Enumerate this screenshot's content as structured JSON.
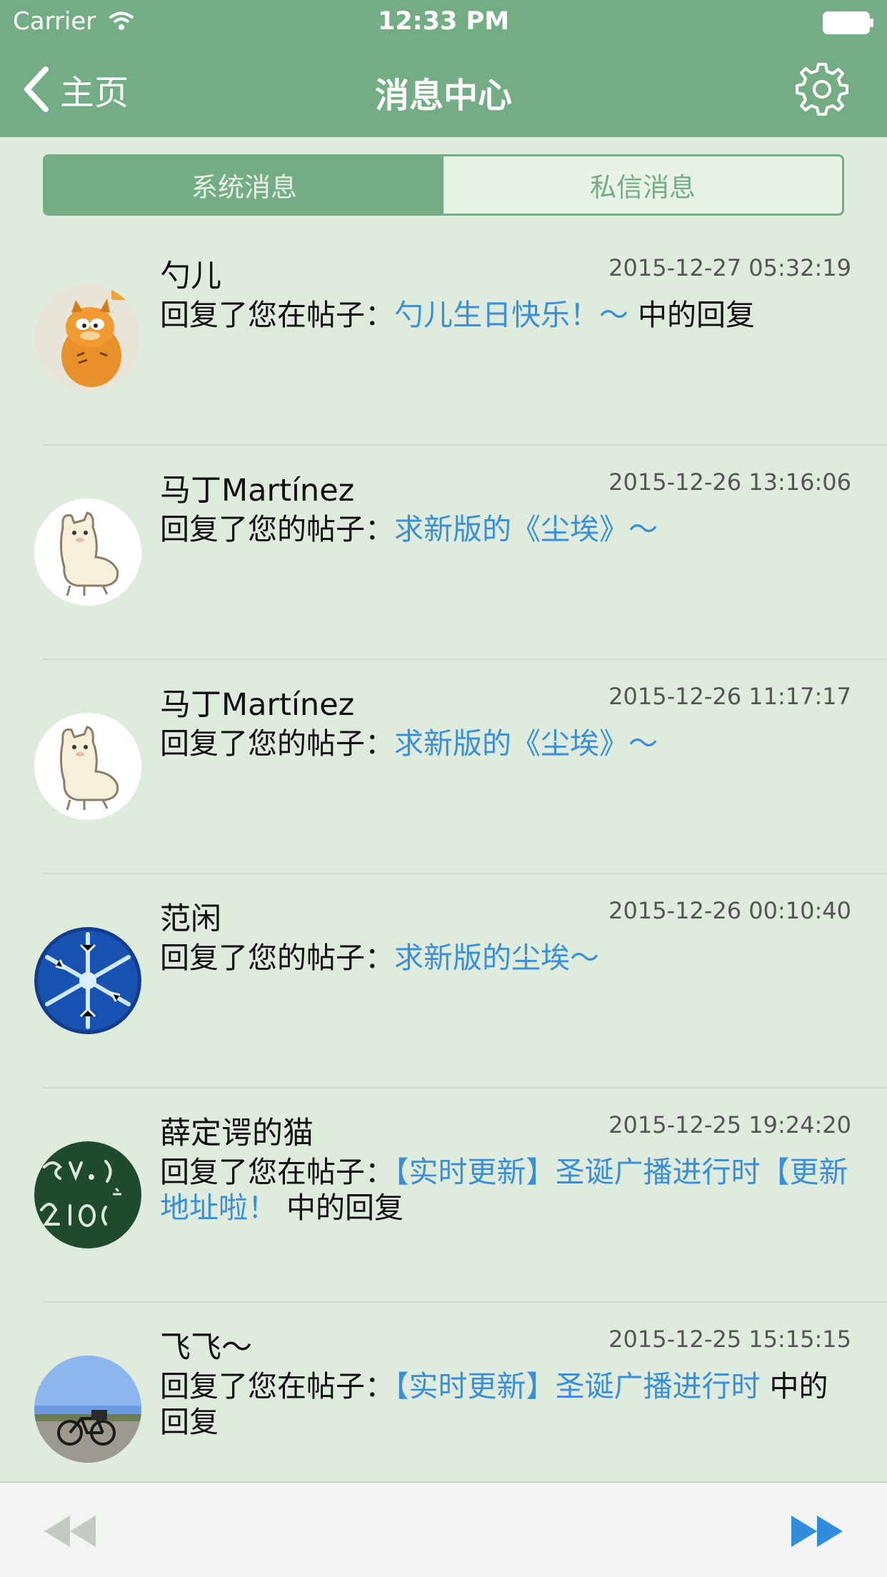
{
  "status_bar": {
    "carrier": "Carrier",
    "time": "12:33 PM"
  },
  "nav": {
    "back_label": "主页",
    "title": "消息中心"
  },
  "tabs": [
    {
      "label": "系统消息",
      "active": true
    },
    {
      "label": "私信消息",
      "active": false
    }
  ],
  "messages": [
    {
      "sender": "勺儿",
      "time": "2015-12-27 05:32:19",
      "prefix": "回复了您在帖子：",
      "link": "勺儿生日快乐！～",
      "suffix": " 中的回复",
      "avatar": "garfield-avatar"
    },
    {
      "sender": "马丁Martínez",
      "time": "2015-12-26 13:16:06",
      "prefix": "回复了您的帖子：",
      "link": "求新版的《尘埃》～",
      "suffix": "",
      "avatar": "alpaca-avatar"
    },
    {
      "sender": "马丁Martínez",
      "time": "2015-12-26 11:17:17",
      "prefix": "回复了您的帖子：",
      "link": "求新版的《尘埃》～",
      "suffix": "",
      "avatar": "alpaca-avatar"
    },
    {
      "sender": "范闲",
      "time": "2015-12-26 00:10:40",
      "prefix": "回复了您的帖子：",
      "link": "求新版的尘埃～",
      "suffix": "",
      "avatar": "snowflake-avatar"
    },
    {
      "sender": "薛定谔的猫",
      "time": "2015-12-25 19:24:20",
      "prefix": "回复了您在帖子：",
      "link": "【实时更新】圣诞广播进行时【更新地址啦！",
      "suffix": " 中的回复",
      "avatar": "chalkboard-avatar"
    },
    {
      "sender": "飞飞～",
      "time": "2015-12-25 15:15:15",
      "prefix": "回复了您在帖子：",
      "link": "【实时更新】圣诞广播进行时",
      "suffix": " 中的回复",
      "avatar": "bicycle-avatar"
    }
  ],
  "colors": {
    "header": "#74ad85",
    "background": "#deebdd",
    "link": "#3a8fd9",
    "next_arrow": "#2f8ddb",
    "prev_arrow_disabled": "#c3cbc3"
  },
  "toolbar": {
    "prev_icon": "rewind-icon",
    "next_icon": "fast-forward-icon"
  }
}
